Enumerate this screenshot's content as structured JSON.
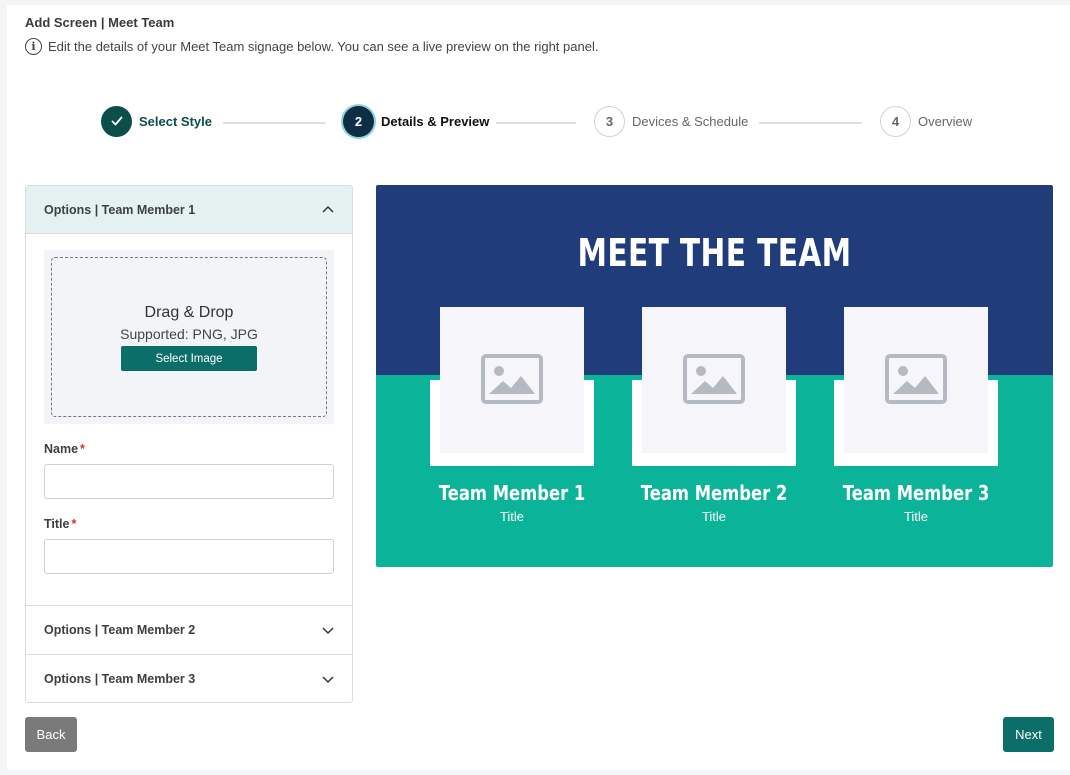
{
  "header": {
    "title": "Add Screen | Meet Team",
    "info_text": "Edit the details of your Meet Team signage below. You can see a live preview on the right panel.",
    "info_icon": "info-icon"
  },
  "stepper": [
    {
      "number": "✓",
      "label": "Select Style",
      "state": "done"
    },
    {
      "number": "2",
      "label": "Details & Preview",
      "state": "active"
    },
    {
      "number": "3",
      "label": "Devices & Schedule",
      "state": "pending"
    },
    {
      "number": "4",
      "label": "Overview",
      "state": "pending"
    }
  ],
  "options": {
    "member1_header": "Options | Team Member 1",
    "member2_header": "Options | Team Member 2",
    "member3_header": "Options | Team Member 3",
    "upload": {
      "title": "Drag & Drop",
      "subtitle": "Supported: PNG, JPG",
      "button": "Select Image"
    },
    "name_label": "Name",
    "title_label": "Title",
    "required_mark": "*",
    "name_value": "",
    "title_value": ""
  },
  "preview": {
    "heading": "MEET THE TEAM",
    "members": [
      {
        "name": "Team Member 1",
        "title": "Title"
      },
      {
        "name": "Team Member 2",
        "title": "Title"
      },
      {
        "name": "Team Member 3",
        "title": "Title"
      }
    ],
    "colors": {
      "top": "#213c7b",
      "bottom": "#0bb398"
    }
  },
  "actions": {
    "back": "Back",
    "next": "Next"
  }
}
